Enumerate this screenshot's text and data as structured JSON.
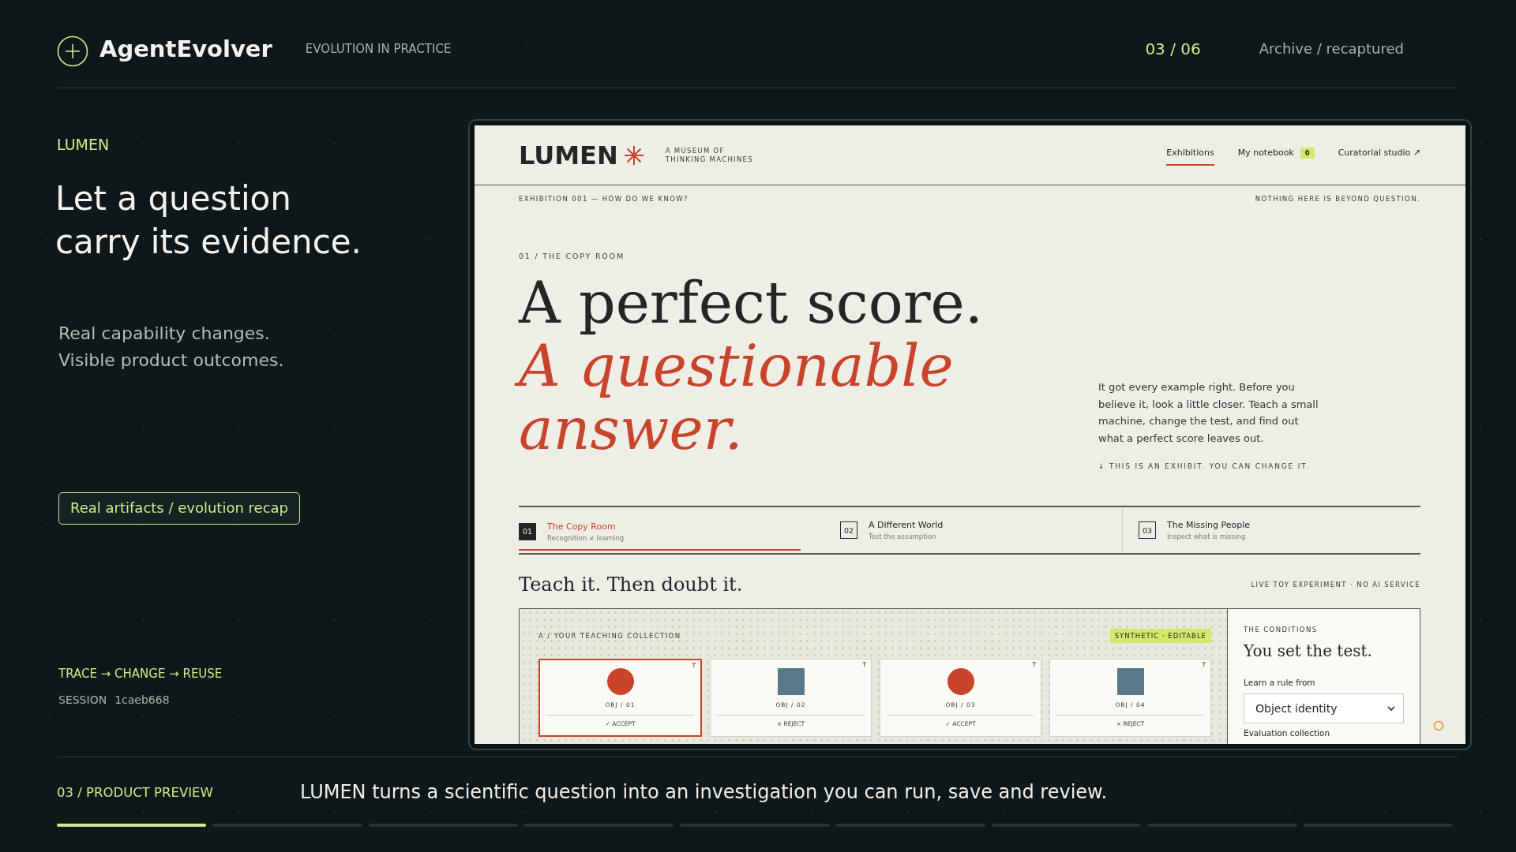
{
  "brand": {
    "name": "AgentEvolver",
    "tagline": "EVOLUTION IN PRACTICE"
  },
  "pager": {
    "position": "03 / 06",
    "label": "Archive / recaptured"
  },
  "intro": {
    "eyebrow": "LUMEN",
    "headline": "Let a question carry its evidence.",
    "subtext": "Real capability changes. Visible product outcomes.",
    "recap_button": "Real artifacts / evolution recap",
    "flow": "TRACE → CHANGE → REUSE",
    "session_label": "SESSION",
    "session_id": "1caeb668"
  },
  "preview": {
    "site": {
      "name": "LUMEN",
      "tagline": "A MUSEUM OF THINKING MACHINES",
      "nav": [
        {
          "label": "Exhibitions",
          "selected": true
        },
        {
          "label": "My notebook",
          "badge": "0",
          "selected": false
        },
        {
          "label": "Curatorial studio ↗",
          "selected": false
        }
      ]
    },
    "strip": {
      "left": "EXHIBITION 001 — HOW DO WE KNOW?",
      "right": "NOTHING HERE IS BEYOND QUESTION."
    },
    "hero": {
      "eyebrow": "01 / THE COPY ROOM",
      "title": "A perfect score.",
      "title_accent": "A questionable answer.",
      "body": "It got every example right. Before you believe it, look a little closer. Teach a small machine, change the test, and find out what a perfect score leaves out.",
      "note": "↓ THIS IS AN EXHIBIT. YOU CAN CHANGE IT."
    },
    "tabs": [
      {
        "number": "01",
        "title": "The Copy Room",
        "subtitle": "Recognition ≠ learning",
        "selected": true
      },
      {
        "number": "02",
        "title": "A Different World",
        "subtitle": "Test the assumption",
        "selected": false
      },
      {
        "number": "03",
        "title": "The Missing People",
        "subtitle": "Inspect what is missing",
        "selected": false
      }
    ],
    "section": {
      "title": "Teach it. Then doubt it.",
      "label": "LIVE TOY EXPERIMENT · NO AI SERVICE"
    },
    "collection": {
      "label": "A / YOUR TEACHING COLLECTION",
      "badge": "SYNTHETIC · EDITABLE",
      "objects": [
        {
          "kind": "circle",
          "corner": "T",
          "name": "OBJ / 01",
          "verdict": "✓ ACCEPT",
          "selected": true
        },
        {
          "kind": "square",
          "corner": "T",
          "name": "OBJ / 02",
          "verdict": "× REJECT",
          "selected": false
        },
        {
          "kind": "circle",
          "corner": "T",
          "name": "OBJ / 03",
          "verdict": "✓ ACCEPT",
          "selected": false
        },
        {
          "kind": "square",
          "corner": "T",
          "name": "OBJ / 04",
          "verdict": "× REJECT",
          "selected": false
        }
      ]
    },
    "conditions": {
      "eyebrow": "THE CONDITIONS",
      "title": "You set the test.",
      "field_label": "Learn a rule from",
      "select_value": "Object identity",
      "next_label": "Evaluation collection"
    }
  },
  "footer": {
    "section": "03 / PRODUCT PREVIEW",
    "caption": "LUMEN turns a scientific question into an investigation you can run, save and review.",
    "progress": [
      {
        "active": true
      },
      {
        "active": false
      },
      {
        "active": false
      },
      {
        "active": false
      },
      {
        "active": false
      },
      {
        "active": false
      },
      {
        "active": false
      },
      {
        "active": false
      },
      {
        "active": false
      }
    ]
  }
}
